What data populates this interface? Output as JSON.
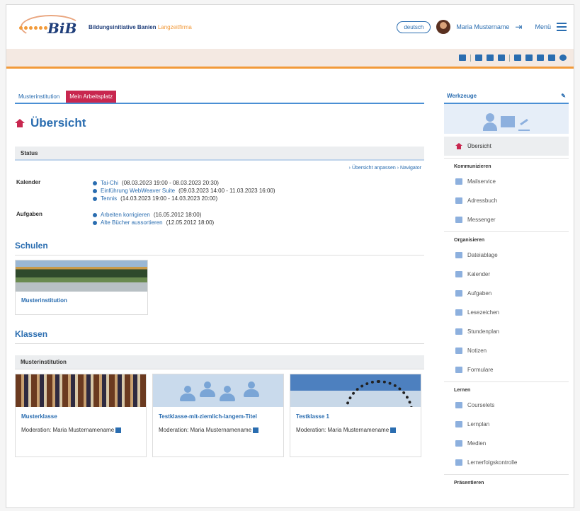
{
  "header": {
    "logo_text": "BiB",
    "logo_subtitle_strong": "Bildungsinitiative Banien",
    "logo_subtitle_accent": "Langzeitfirma",
    "language_button": "deutsch",
    "user_name": "Maria Mustername",
    "menu_label": "Menü"
  },
  "tabs": [
    {
      "label": "Musterinstitution",
      "active": false
    },
    {
      "label": "Mein Arbeitsplatz",
      "active": true
    }
  ],
  "page_title": "Übersicht",
  "status": {
    "label": "Status",
    "links": "› Übersicht anpassen › Navigator",
    "calendar_label": "Kalender",
    "calendar_entries": [
      {
        "title": "Tai-Chi",
        "meta": "(08.03.2023 19:00 - 08.03.2023 20:30)"
      },
      {
        "title": "Einführung WebWeaver Suite",
        "meta": "(09.03.2023 14:00 - 11.03.2023 16:00)"
      },
      {
        "title": "Tennis",
        "meta": "(14.03.2023 19:00 - 14.03.2023 20:00)"
      }
    ],
    "tasks_label": "Aufgaben",
    "task_entries": [
      {
        "title": "Arbeiten korrigieren",
        "meta": "(16.05.2012 18:00)"
      },
      {
        "title": "Alte Bücher aussortieren",
        "meta": "(12.05.2012 18:00)"
      }
    ]
  },
  "schools": {
    "title": "Schulen",
    "card_label": "Musterinstitution"
  },
  "classes": {
    "title": "Klassen",
    "group": "Musterinstitution",
    "cards": [
      {
        "title": "Musterklasse",
        "moderation": "Moderation: Maria Musternamename"
      },
      {
        "title": "Testklasse-mit-ziemlich-langem-Titel",
        "moderation": "Moderation: Maria Musternamename"
      },
      {
        "title": "Testklasse 1",
        "moderation": "Moderation: Maria Musternamename"
      }
    ]
  },
  "sidebar": {
    "title": "Werkzeuge",
    "overview": "Übersicht",
    "sections": [
      {
        "label": "Kommunizieren",
        "items": [
          "Mailservice",
          "Adressbuch",
          "Messenger"
        ]
      },
      {
        "label": "Organisieren",
        "items": [
          "Dateiablage",
          "Kalender",
          "Aufgaben",
          "Lesezeichen",
          "Stundenplan",
          "Notizen",
          "Formulare"
        ]
      },
      {
        "label": "Lernen",
        "items": [
          "Courselets",
          "Lernplan",
          "Medien",
          "Lernerfolgskontrolle"
        ]
      },
      {
        "label": "Präsentieren",
        "items": []
      }
    ]
  },
  "colors": {
    "accent": "#c8274f",
    "link": "#2a6db0",
    "orange": "#f29a3a"
  }
}
